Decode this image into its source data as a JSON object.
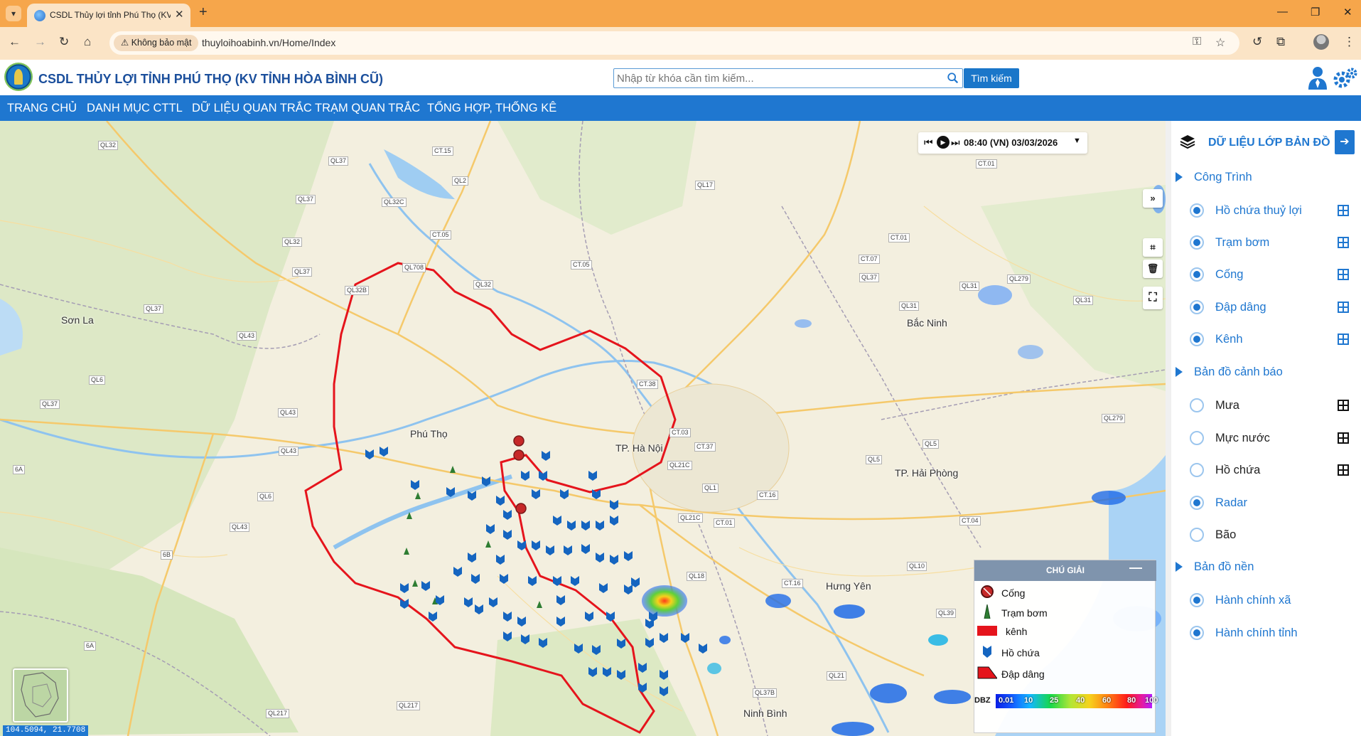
{
  "browser": {
    "tab_title": "CSDL Thủy lợi tỉnh Phú Thọ (KV",
    "security_label": "Không bảo mật",
    "url": "thuyloihoabinh.vn/Home/Index"
  },
  "header": {
    "title": "CSDL THỦY LỢI TỈNH PHÚ THỌ (KV TỈNH HÒA BÌNH CŨ)",
    "search_placeholder": "Nhập từ khóa cần tìm kiếm...",
    "search_button": "Tìm kiếm"
  },
  "nav": {
    "items": [
      "TRANG CHỦ",
      "DANH MỤC CTTL",
      "DỮ LIỆU QUAN TRẮC",
      "TRẠM QUAN TRẮC",
      "TỔNG HỢP, THỐNG KÊ"
    ]
  },
  "map": {
    "time_label": "08:40 (VN) 03/03/2026",
    "coordinates": "104.5094, 21.7708",
    "place_labels": [
      "Sơn La",
      "Phú Thọ",
      "TP. Hà Nội",
      "Bắc Ninh",
      "TP. Hải Phòng",
      "Hưng Yên",
      "Ninh Bình"
    ],
    "road_labels": [
      "QL32",
      "CT.15",
      "QL37",
      "QL2",
      "QL32C",
      "QL37",
      "QL32",
      "CT.05",
      "QL708",
      "QL37",
      "QL32B",
      "QL32",
      "CT.05",
      "QL37",
      "QL43",
      "QL6",
      "QL37",
      "QL43",
      "QL43",
      "QL6",
      "QL43",
      "QL217",
      "QL217",
      "CT.38",
      "CT.03",
      "CT.37",
      "QL21C",
      "QL1",
      "QL21C",
      "CT.01",
      "CT.16",
      "CT.01",
      "QL17",
      "CT.01",
      "QL37",
      "CT.07",
      "QL31",
      "QL279",
      "QL31",
      "QL31",
      "QL5",
      "QL5",
      "QL279",
      "CT.04",
      "CT.16",
      "QL10",
      "QL39",
      "QL21",
      "QL37B",
      "QL18",
      "6A",
      "6B",
      "6A"
    ],
    "legend": {
      "title": "CHÚ GIẢI",
      "items": [
        "Cống",
        "Trạm bơm",
        "kênh",
        "Hồ chứa",
        "Đập dâng"
      ],
      "dbz_label": "DBZ",
      "dbz_ticks": [
        "0.01",
        "10",
        "25",
        "40",
        "60",
        "80",
        "100"
      ]
    }
  },
  "panel": {
    "title": "DỮ LIỆU LỚP BẢN ĐỒ",
    "groups": [
      {
        "label": "Công Trình",
        "layers": [
          {
            "label": "Hồ chứa thuỷ lợi",
            "checked": true
          },
          {
            "label": "Trạm bơm",
            "checked": true
          },
          {
            "label": "Cống",
            "checked": true
          },
          {
            "label": "Đập dâng",
            "checked": true
          },
          {
            "label": "Kênh",
            "checked": true
          }
        ]
      },
      {
        "label": "Bản đồ cảnh báo",
        "layers": [
          {
            "label": "Mưa",
            "checked": false
          },
          {
            "label": "Mực nước",
            "checked": false
          },
          {
            "label": "Hồ chứa",
            "checked": false
          },
          {
            "label": "Radar",
            "checked": true
          },
          {
            "label": "Bão",
            "checked": false
          }
        ]
      },
      {
        "label": "Bản đồ nền",
        "layers": [
          {
            "label": "Hành chính xã",
            "checked": true
          },
          {
            "label": "Hành chính tỉnh",
            "checked": true
          }
        ]
      }
    ]
  },
  "colors": {
    "accent": "#1f77d0",
    "boundary": "#e5141c",
    "reservoir": "#1565c0",
    "pump": "#2e7d32"
  },
  "icons": [
    "search-icon",
    "user-icon",
    "settings-icon",
    "layers-icon",
    "grid-icon",
    "play-icon",
    "skip-back-icon",
    "skip-forward-icon",
    "expand-icon",
    "trash-icon",
    "crop-icon"
  ]
}
